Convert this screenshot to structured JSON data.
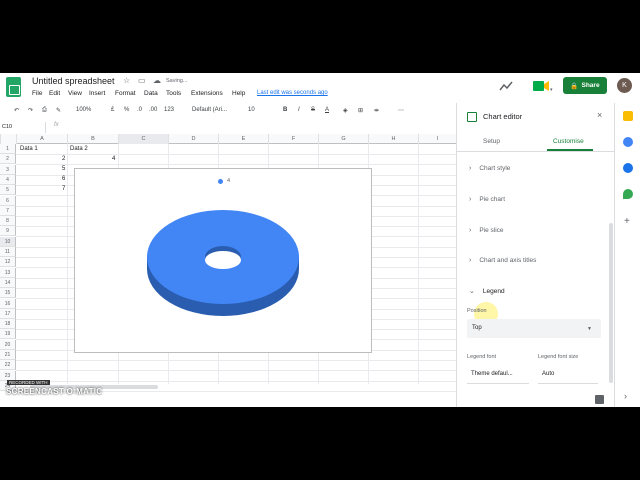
{
  "app": {
    "doc_title": "Untitled spreadsheet",
    "saving": "Saving...",
    "last_edit": "Last edit was seconds ago",
    "share_label": "Share",
    "avatar_letter": "K"
  },
  "menu": [
    "File",
    "Edit",
    "View",
    "Insert",
    "Format",
    "Data",
    "Tools",
    "Extensions",
    "Help"
  ],
  "toolbar": {
    "zoom": "100%",
    "currency": "£",
    "percent": "%",
    "dec_decrease": ".0",
    "dec_increase": ".00",
    "format_more": "123",
    "font": "Default (Ari...",
    "font_size": "10",
    "bold": "B",
    "italic": "I",
    "strike": "S",
    "text_color": "A",
    "more": "⋯"
  },
  "formula": {
    "name_box": "C10",
    "fx": "fx"
  },
  "grid": {
    "columns": [
      "A",
      "B",
      "C",
      "D",
      "E",
      "F",
      "G",
      "H",
      "I"
    ],
    "rows": [
      "1",
      "2",
      "3",
      "4",
      "5",
      "6",
      "7",
      "8",
      "9",
      "10",
      "11",
      "12",
      "13",
      "14",
      "15",
      "16",
      "17",
      "18",
      "19",
      "20",
      "21",
      "22",
      "23",
      "24"
    ],
    "cells": {
      "A1": "Data 1",
      "B1": "Data 2",
      "B2": "2",
      "C2": "4",
      "B3": "5",
      "B4": "6",
      "B5": "7"
    }
  },
  "chart_data": {
    "type": "pie",
    "style": "3d-donut",
    "legend": [
      "4"
    ],
    "legend_position": "top",
    "values": [
      4
    ],
    "colors": [
      "#4285f4"
    ]
  },
  "panel": {
    "title": "Chart editor",
    "tabs": {
      "setup": "Setup",
      "customise": "Customise"
    },
    "sections": [
      "Chart style",
      "Pie chart",
      "Pie slice",
      "Chart and axis titles",
      "Legend"
    ],
    "position_label": "Position",
    "position_value": "Top",
    "legend_font_label": "Legend font",
    "legend_font_value": "Theme defaul...",
    "legend_font_size_label": "Legend font size",
    "legend_font_size_value": "Auto"
  },
  "watermark": {
    "top": "RECORDED WITH",
    "brand": "SCREENCAST-O-MATIC"
  },
  "colors": {
    "accent": "#188038",
    "chart_blue": "#4285f4"
  }
}
